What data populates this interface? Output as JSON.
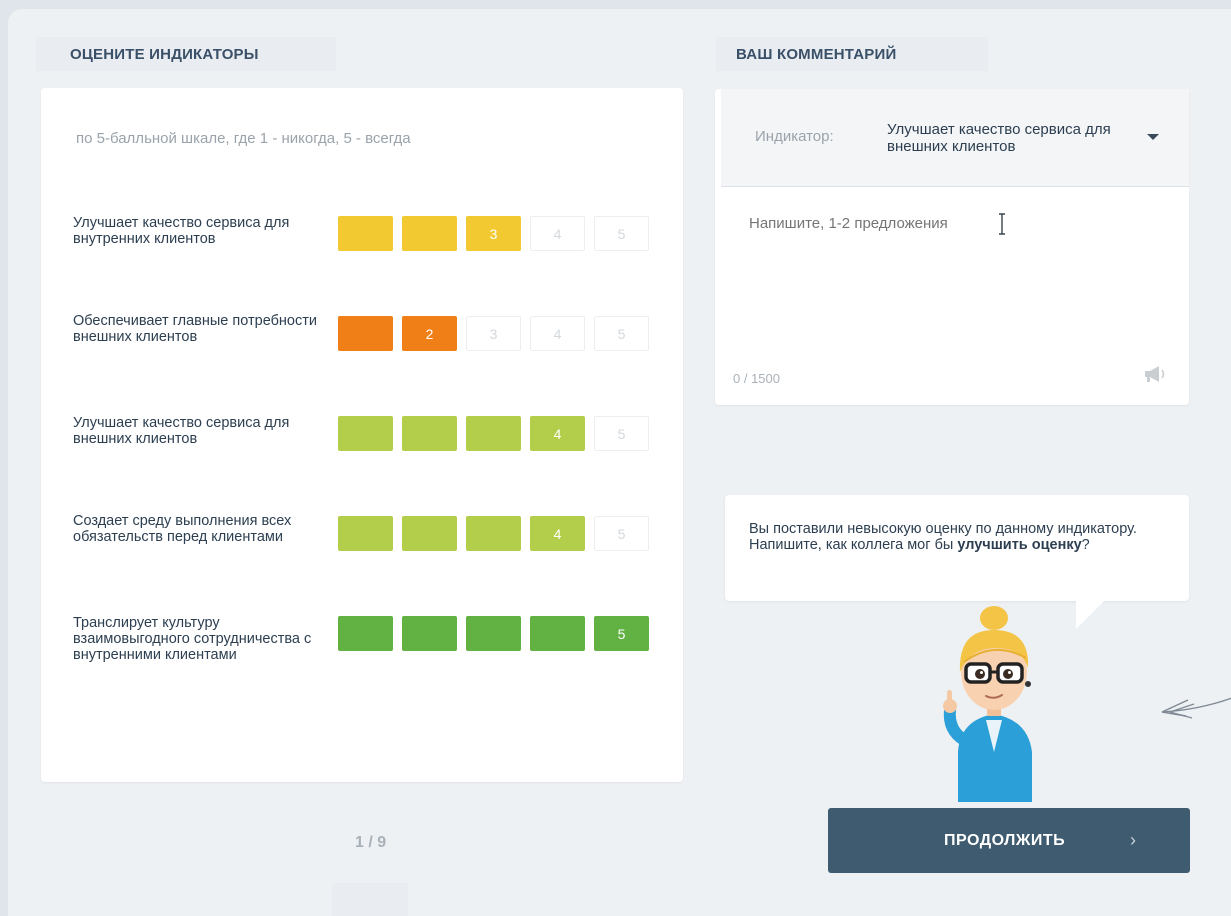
{
  "left": {
    "title": "ОЦЕНИТЕ ИНДИКАТОРЫ",
    "hint": "по 5-балльной шкале, где 1 - никогда, 5 - всегда",
    "rows": [
      {
        "label": "Улучшает качество сервиса для внутренних клиентов",
        "score": 3,
        "color": "#f2c930"
      },
      {
        "label": "Обеспечивает главные потребности внешних клиентов",
        "score": 2,
        "color": "#f07f17"
      },
      {
        "label": "Улучшает качество сервиса для внешних клиентов",
        "score": 4,
        "color": "#b3ce4a"
      },
      {
        "label": "Создает среду выполнения всех обязательств перед клиентами",
        "score": 4,
        "color": "#b3ce4a"
      },
      {
        "label": "Транслирует культуру взаимовыгодного сотрудничества с внутренними клиентами",
        "score": 5,
        "color": "#62b143"
      }
    ],
    "scale": [
      "1",
      "2",
      "3",
      "4",
      "5"
    ],
    "pager": "1 / 9"
  },
  "right": {
    "title": "ВАШ КОММЕНТАРИЙ",
    "indicator_label": "Индикатор:",
    "indicator_value": "Улучшает качество сервиса для внешних клиентов",
    "comment_placeholder": "Напишите, 1-2 предложения",
    "counter": "0 / 1500",
    "tip_text": "Вы поставили невысокую оценку по данному индикатору. Напишите, как коллега мог бы ",
    "tip_bold": "улучшить оценку",
    "tip_end": "?",
    "continue_label": "ПРОДОЛЖИТЬ",
    "continue_chevron": "›"
  },
  "icons": {
    "dropdown": "caret-down-icon",
    "megaphone": "megaphone-icon",
    "text_cursor": "text-cursor-icon"
  }
}
